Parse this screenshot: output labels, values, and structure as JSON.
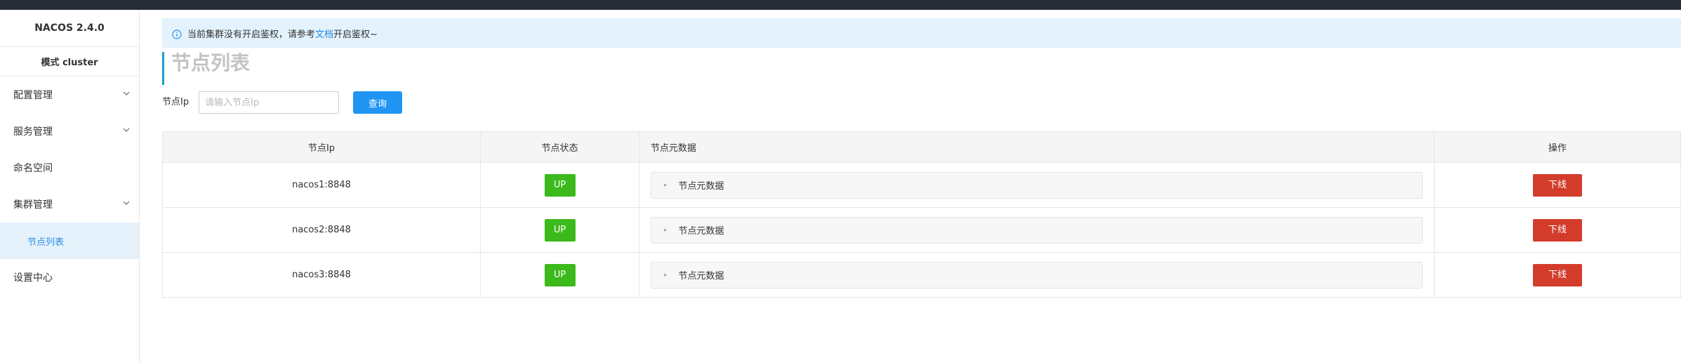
{
  "app": {
    "brand": "NACOS 2.4.0",
    "mode": "模式 cluster"
  },
  "sidebar": {
    "items": [
      {
        "label": "配置管理",
        "icon": "chevron-down-icon"
      },
      {
        "label": "服务管理",
        "icon": "chevron-down-icon"
      },
      {
        "label": "命名空间"
      },
      {
        "label": "集群管理",
        "icon": "chevron-down-icon"
      }
    ],
    "sub_item": {
      "label": "节点列表"
    },
    "last_item": {
      "label": "设置中心"
    }
  },
  "notice": {
    "text_before": "当前集群没有开启鉴权，请参考",
    "link": "文档",
    "text_after": "开启鉴权~",
    "icon": "info-icon"
  },
  "page": {
    "title": "节点列表"
  },
  "filter": {
    "label": "节点Ip",
    "placeholder": "请输入节点Ip",
    "button": "查询"
  },
  "table": {
    "headers": {
      "ip": "节点Ip",
      "status": "节点状态",
      "meta": "节点元数据",
      "op": "操作"
    },
    "rows": [
      {
        "ip": "nacos1:8848",
        "status": "UP",
        "meta": "节点元数据",
        "action": "下线"
      },
      {
        "ip": "nacos2:8848",
        "status": "UP",
        "meta": "节点元数据",
        "action": "下线"
      },
      {
        "ip": "nacos3:8848",
        "status": "UP",
        "meta": "节点元数据",
        "action": "下线"
      }
    ]
  },
  "colors": {
    "accent": "#2195f3",
    "up_status": "#3cb91b",
    "offline": "#d33c2b",
    "topbar": "#262c34",
    "notice_bg": "#e3f2fc"
  }
}
